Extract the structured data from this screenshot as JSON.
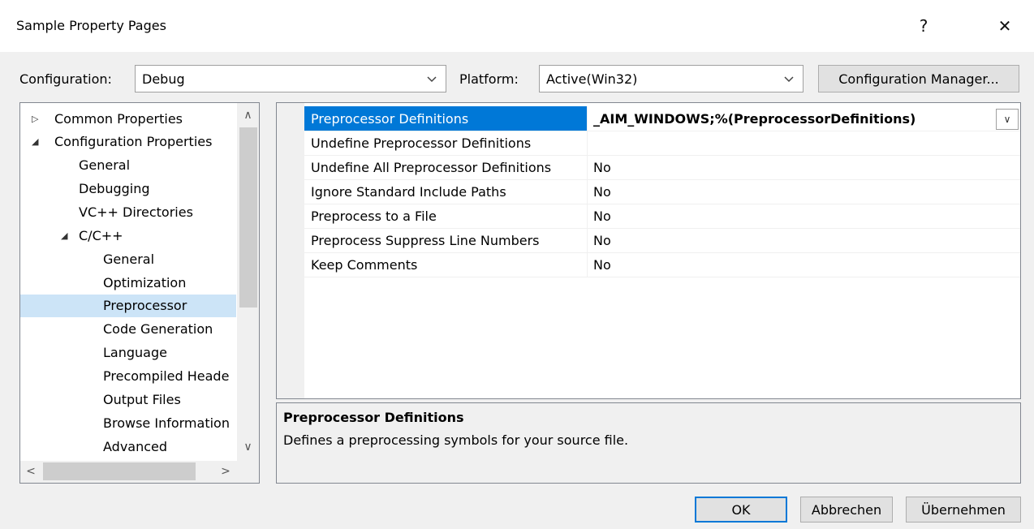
{
  "window": {
    "title": "Sample Property Pages",
    "help_label": "?",
    "close_label": "✕"
  },
  "config_bar": {
    "configuration_label": "Configuration:",
    "configuration_value": "Debug",
    "platform_label": "Platform:",
    "platform_value": "Active(Win32)",
    "config_manager_label": "Configuration Manager..."
  },
  "tree": {
    "items": [
      {
        "label": "Common Properties",
        "arrow": "▷"
      },
      {
        "label": "Configuration Properties",
        "arrow": "◢"
      },
      {
        "label": "General"
      },
      {
        "label": "Debugging"
      },
      {
        "label": "VC++ Directories"
      },
      {
        "label": "C/C++",
        "arrow": "◢"
      },
      {
        "label": "General"
      },
      {
        "label": "Optimization"
      },
      {
        "label": "Preprocessor",
        "selected": true
      },
      {
        "label": "Code Generation"
      },
      {
        "label": "Language"
      },
      {
        "label": "Precompiled Heade"
      },
      {
        "label": "Output Files"
      },
      {
        "label": "Browse Information"
      },
      {
        "label": "Advanced"
      }
    ],
    "scroll_up": "∧",
    "scroll_down": "∨",
    "scroll_left": "<",
    "scroll_right": ">"
  },
  "grid": {
    "rows": [
      {
        "name": "Preprocessor Definitions",
        "value": "_AIM_WINDOWS;%(PreprocessorDefinitions)",
        "selected": true
      },
      {
        "name": "Undefine Preprocessor Definitions",
        "value": ""
      },
      {
        "name": "Undefine All Preprocessor Definitions",
        "value": "No"
      },
      {
        "name": "Ignore Standard Include Paths",
        "value": "No"
      },
      {
        "name": "Preprocess to a File",
        "value": "No"
      },
      {
        "name": "Preprocess Suppress Line Numbers",
        "value": "No"
      },
      {
        "name": "Keep Comments",
        "value": "No"
      }
    ],
    "dropdown_glyph": "∨"
  },
  "description": {
    "title": "Preprocessor Definitions",
    "text": "Defines a preprocessing symbols for your source file."
  },
  "buttons": {
    "ok": "OK",
    "cancel": "Abbrechen",
    "apply": "Übernehmen"
  }
}
